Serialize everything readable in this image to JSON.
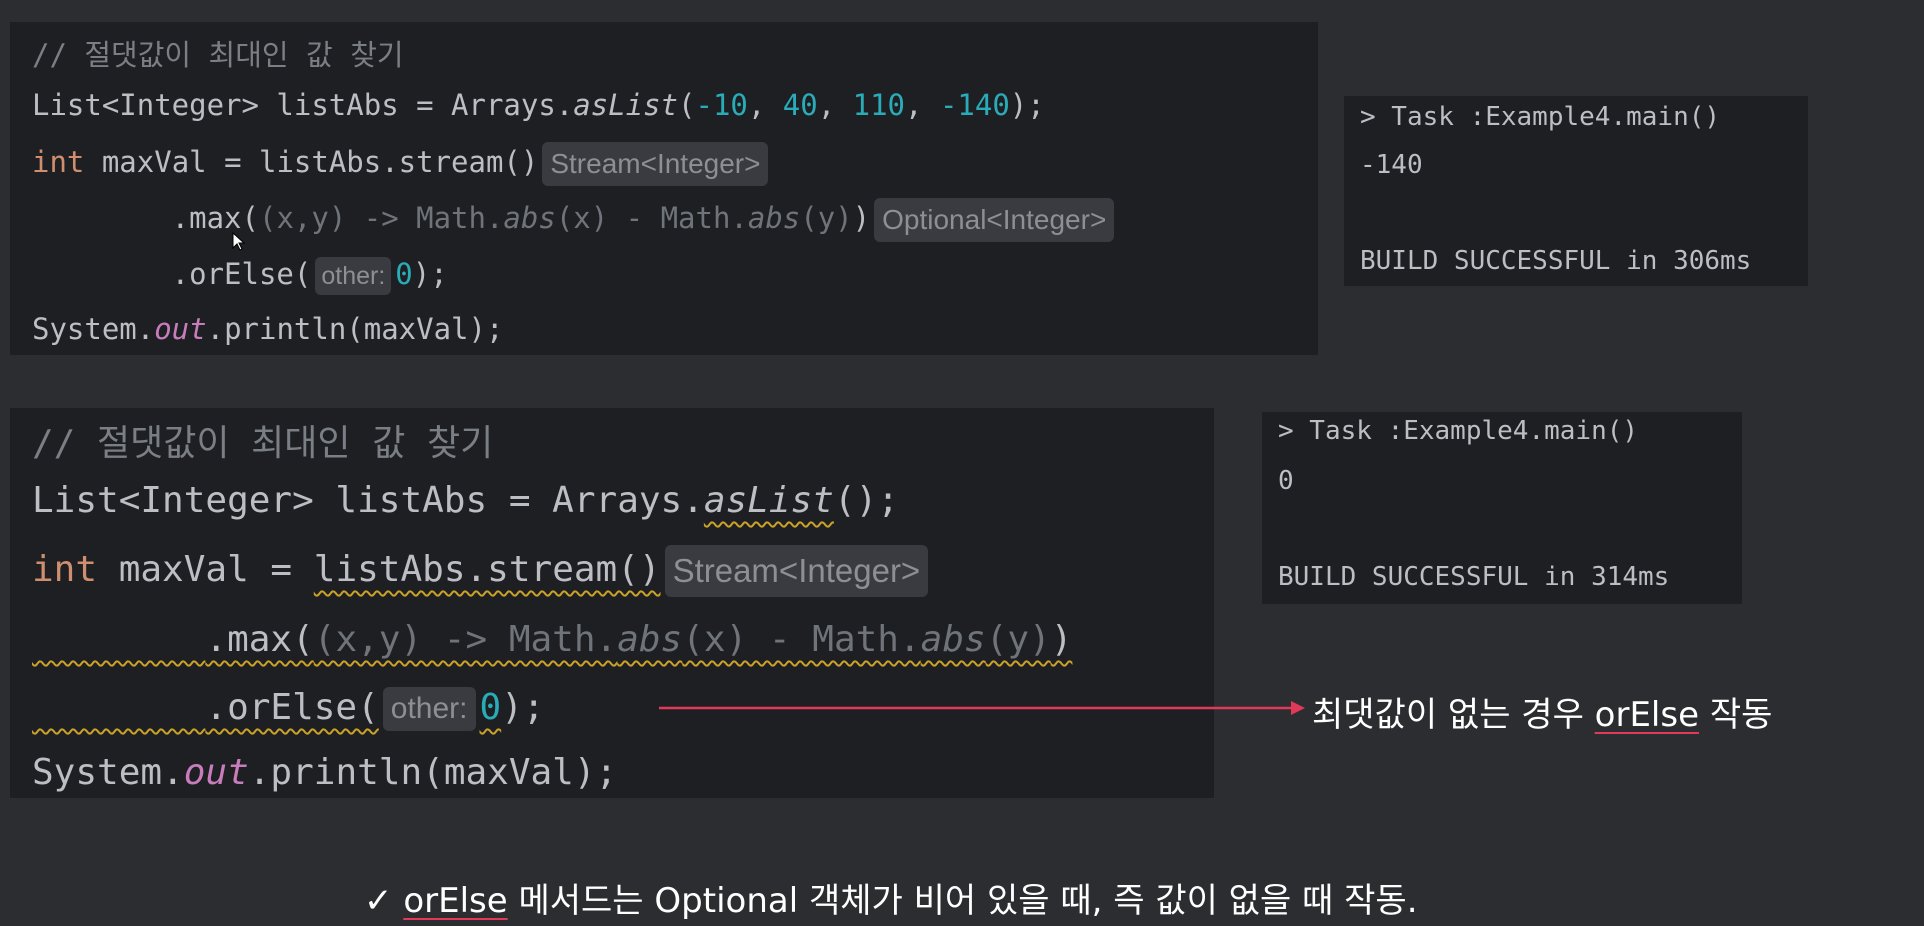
{
  "top": {
    "code": {
      "comment": "// 절댓값이 최대인 값 찾기",
      "l2_decl": "List<Integer> listAbs = Arrays.",
      "l2_method": "asList",
      "l2_open": "(",
      "l2_n1": "-10",
      "l2_sep1": ", ",
      "l2_n2": "40",
      "l2_sep2": ", ",
      "l2_n3": "110",
      "l2_sep3": ", ",
      "l2_n4": "-140",
      "l2_close": ");",
      "l3_kw": "int",
      "l3_rest": " maxVal = listAbs.stream()",
      "l3_hint": "Stream<Integer>",
      "l4_indent": "        .max(",
      "l4_lambda_a": "(x,y) -> Math.",
      "l4_abs1": "abs",
      "l4_lambda_b": "(x) - Math.",
      "l4_abs2": "abs",
      "l4_lambda_c": "(y)",
      "l4_close": ")",
      "l4_hint": "Optional<Integer>",
      "l5_indent": "        .orElse(",
      "l5_hint": "other:",
      "l5_num": "0",
      "l5_close": ");",
      "l6_a": "System.",
      "l6_out": "out",
      "l6_b": ".println(maxVal);"
    },
    "terminal": {
      "task": "> Task :Example4.main()",
      "output": "-140",
      "build": "BUILD SUCCESSFUL in 306ms"
    }
  },
  "bottom": {
    "code": {
      "comment": "// 절댓값이 최대인 값 찾기",
      "l2_decl": "List<Integer> listAbs = Arrays.",
      "l2_method": "asList",
      "l2_close": "();",
      "l3_kw": "int",
      "l3_mid": " maxVal = ",
      "l3_call": "listAbs.stream()",
      "l3_hint": "Stream<Integer>",
      "l4_indent": "        ",
      "l4_max": ".max(",
      "l4_lambda_a": "(x,y) -> Math.",
      "l4_abs1": "abs",
      "l4_lambda_b": "(x) - Math.",
      "l4_abs2": "abs",
      "l4_lambda_c": "(y)",
      "l4_close": ")",
      "l5_indent": "        ",
      "l5_orelse": ".orElse(",
      "l5_hint": "other:",
      "l5_num": "0",
      "l5_close": ");",
      "l6_a": "System.",
      "l6_out": "out",
      "l6_b": ".println(maxVal);"
    },
    "terminal": {
      "task": "> Task :Example4.main()",
      "output": "0",
      "build": "BUILD SUCCESSFUL in 314ms"
    }
  },
  "annotation": {
    "prefix": "최댓값이 없는 경우 ",
    "keyword": "orElse",
    "suffix": " 작동"
  },
  "caption": {
    "check": "✓",
    "keyword": "orElse",
    "text": " 메서드는 Optional 객체가 비어 있을 때, 즉 값이 없을 때 작동."
  },
  "colors": {
    "background": "#2b2d30",
    "editor": "#1e1f22",
    "arrow": "#e2385a",
    "warning_underline": "#c9a227"
  }
}
